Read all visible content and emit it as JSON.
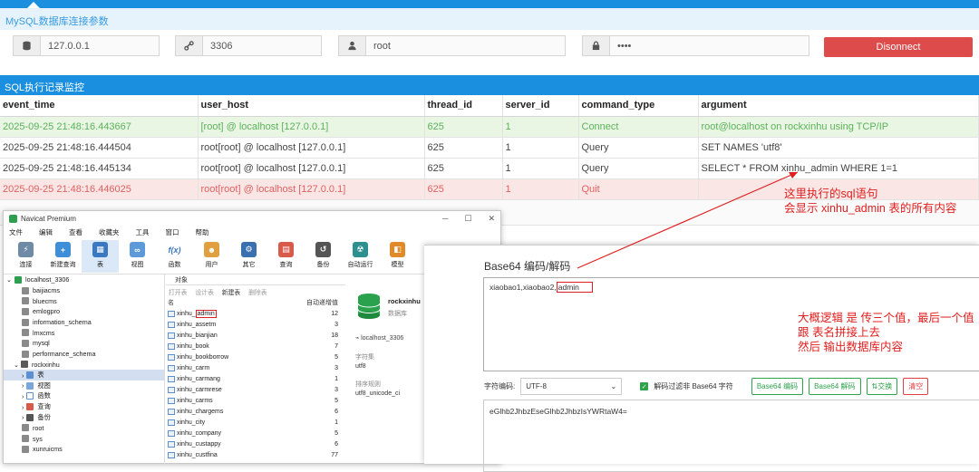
{
  "conn": {
    "title": "MySQL数据库连接参数",
    "host": "127.0.0.1",
    "port": "3306",
    "user": "root",
    "password": "••••",
    "disconnect_label": "Disonnect"
  },
  "monitor": {
    "title": "SQL执行记录监控",
    "columns": [
      "event_time",
      "user_host",
      "thread_id",
      "server_id",
      "command_type",
      "argument"
    ],
    "rows": [
      [
        "2025-09-25 21:48:16.443667",
        "[root] @ localhost [127.0.0.1]",
        "625",
        "1",
        "Connect",
        "root@localhost on rockxinhu using TCP/IP"
      ],
      [
        "2025-09-25 21:48:16.444504",
        "root[root] @ localhost [127.0.0.1]",
        "625",
        "1",
        "Query",
        "SET NAMES 'utf8'"
      ],
      [
        "2025-09-25 21:48:16.445134",
        "root[root] @ localhost [127.0.0.1]",
        "625",
        "1",
        "Query",
        "SELECT * FROM xinhu_admin WHERE 1=1"
      ],
      [
        "2025-09-25 21:48:16.446025",
        "root[root] @ localhost [127.0.0.1]",
        "625",
        "1",
        "Quit",
        ""
      ]
    ]
  },
  "annotation1": [
    "这里执行的sql语句",
    "会显示 xinhu_admin 表的所有内容"
  ],
  "navicat": {
    "title": "Navicat Premium",
    "menu": [
      "文件",
      "编辑",
      "查看",
      "收藏夹",
      "工具",
      "窗口",
      "帮助"
    ],
    "toolbar": [
      "连接",
      "新建查询",
      "表",
      "视图",
      "函数",
      "用户",
      "其它",
      "查询",
      "备份",
      "自动运行",
      "模型"
    ],
    "tree": [
      {
        "label": "localhost_3306",
        "indent": 0,
        "open": true
      },
      {
        "label": "baijiacms",
        "indent": 1
      },
      {
        "label": "bluecms",
        "indent": 1
      },
      {
        "label": "emlogpro",
        "indent": 1
      },
      {
        "label": "information_schema",
        "indent": 1
      },
      {
        "label": "lmxcms",
        "indent": 1
      },
      {
        "label": "mysql",
        "indent": 1
      },
      {
        "label": "performance_schema",
        "indent": 1
      },
      {
        "label": "rockxinhu",
        "indent": 1,
        "open": true
      },
      {
        "label": "表",
        "indent": 2,
        "sel": true
      },
      {
        "label": "视图",
        "indent": 2
      },
      {
        "label": "函数",
        "indent": 2
      },
      {
        "label": "查询",
        "indent": 2
      },
      {
        "label": "备份",
        "indent": 2
      },
      {
        "label": "root",
        "indent": 1
      },
      {
        "label": "sys",
        "indent": 1
      },
      {
        "label": "xunruicms",
        "indent": 1
      }
    ],
    "mid_tab": "对象",
    "mid_bar": [
      "打开表",
      "设计表",
      "新建表",
      "删除表"
    ],
    "mid_head": [
      "名",
      "自动递增值"
    ],
    "tables": [
      [
        "xinhu_",
        "admin",
        "12"
      ],
      [
        "xinhu_assetm",
        "",
        "3"
      ],
      [
        "xinhu_bianjian",
        "",
        "18"
      ],
      [
        "xinhu_book",
        "",
        "7"
      ],
      [
        "xinhu_bookborrow",
        "",
        "5"
      ],
      [
        "xinhu_carm",
        "",
        "3"
      ],
      [
        "xinhu_carmang",
        "",
        "1"
      ],
      [
        "xinhu_carmrese",
        "",
        "3"
      ],
      [
        "xinhu_carms",
        "",
        "5"
      ],
      [
        "xinhu_chargems",
        "",
        "6"
      ],
      [
        "xinhu_city",
        "",
        "1"
      ],
      [
        "xinhu_company",
        "",
        "5"
      ],
      [
        "xinhu_custappy",
        "",
        "6"
      ],
      [
        "xinhu_custfina",
        "",
        "77"
      ]
    ],
    "right": {
      "db_name": "rockxinhu",
      "db_sub": "数据库",
      "conn": "localhost_3306",
      "charset_label": "字符集",
      "charset": "utf8",
      "collation_label": "排序规则",
      "collation": "utf8_unicode_ci"
    }
  },
  "b64": {
    "title": "Base64 编码/解码",
    "input_prefix": "xiaobao1,xiaobao2,",
    "input_hl": "admin",
    "charset_label": "字符编码:",
    "charset": "UTF-8",
    "filter_label": "解码过滤非 Base64 字符",
    "btn_encode": "Base64 编码",
    "btn_decode": "Base64 解码",
    "btn_swap": "交换",
    "btn_clear": "清空",
    "output": "eGlhb2JhbzEseGlhb2JhbzIsYWRtaW4="
  },
  "annotation2": [
    "大概逻辑  是  传三个值，最后一个值",
    "跟 表名拼接上去",
    "然后 输出数据库内容"
  ],
  "colors": {
    "accent": "#1a8fe0",
    "danger": "#dd4b4b",
    "annotation": "#e02020",
    "success": "#2ea34c"
  }
}
